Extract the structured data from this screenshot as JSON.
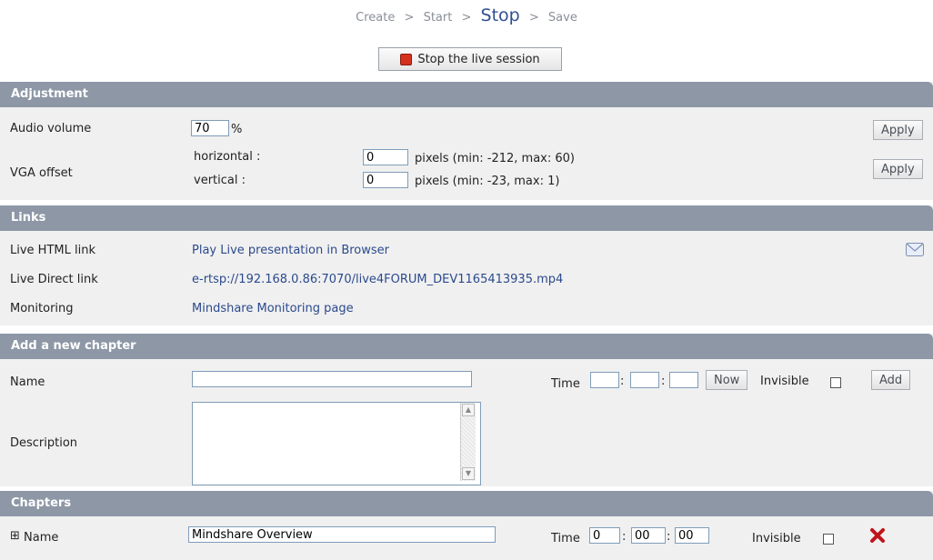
{
  "breadcrumb": {
    "steps": [
      "Create",
      "Start",
      "Stop",
      "Save"
    ],
    "separator": ">"
  },
  "stop_button": {
    "label": "Stop the live session",
    "icon": "stop-square-icon",
    "icon_color": "#d4311e"
  },
  "adjustment": {
    "title": "Adjustment",
    "audio_label": "Audio volume",
    "audio_value": "70",
    "audio_unit": "%",
    "apply_label": "Apply",
    "vga_label": "VGA offset",
    "horizontal_label": "horizontal :",
    "horizontal_value": "0",
    "horizontal_hint": "pixels (min: -212, max: 60)",
    "vertical_label": "vertical :",
    "vertical_value": "0",
    "vertical_hint": "pixels (min: -23, max: 1)"
  },
  "links": {
    "title": "Links",
    "html_label": "Live HTML link",
    "html_link": "Play Live presentation in Browser",
    "direct_label": "Live Direct link",
    "direct_link": "e-rtsp://192.168.0.86:7070/live4FORUM_DEV1165413935.mp4",
    "monitor_label": "Monitoring",
    "monitor_link": "Mindshare Monitoring page",
    "email_icon": "envelope-icon"
  },
  "new_chapter": {
    "title": "Add a new chapter",
    "name_label": "Name",
    "name_value": "",
    "time_label": "Time",
    "hh": "",
    "mm": "",
    "ss": "",
    "colon": ":",
    "now_label": "Now",
    "invisible_label": "Invisible",
    "add_label": "Add",
    "description_label": "Description",
    "description_value": ""
  },
  "chapters": {
    "title": "Chapters",
    "rows": [
      {
        "expand": "⊞",
        "name_label": "Name",
        "name_value": "Mindshare Overview",
        "time_label": "Time",
        "hh": "0",
        "mm": "00",
        "ss": "00",
        "invisible_label": "Invisible",
        "delete_icon": "delete-x-icon",
        "delete_color": "#c0141a"
      }
    ]
  },
  "colors": {
    "section_header": "#8d97a6",
    "section_body": "#f0f0f0",
    "link": "#2b4a8c"
  }
}
